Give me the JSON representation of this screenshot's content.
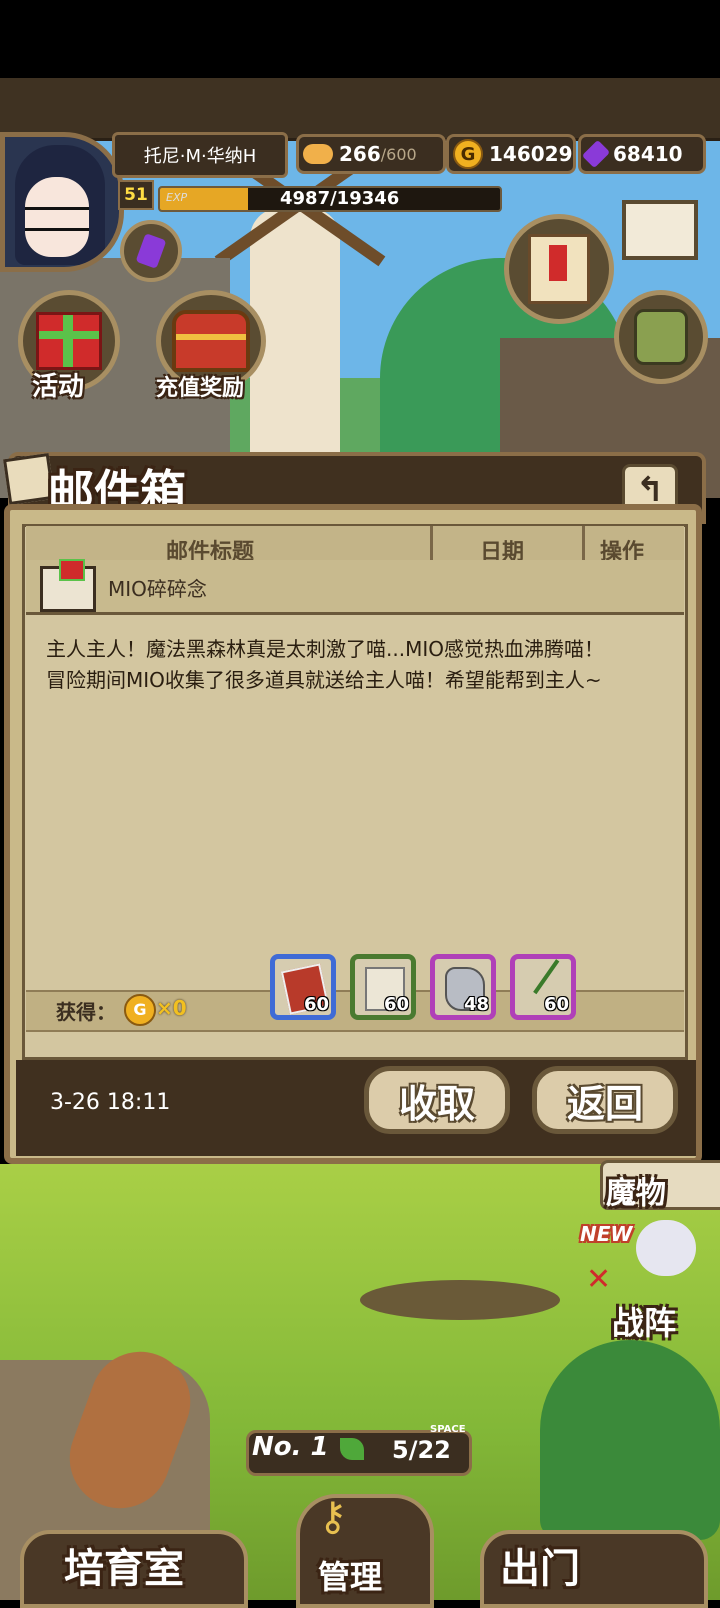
{
  "player": {
    "name": "托尼·M·华纳H",
    "level": "51",
    "exp_label": "EXP",
    "exp_text": "4987/19346",
    "exp_fraction": 0.258
  },
  "resources": {
    "stamina": "266",
    "stamina_max": "/600",
    "gold": "146029",
    "gems": "68410"
  },
  "hud_buttons": {
    "activity": "活动",
    "recharge_reward": "充值奖励"
  },
  "mailbox": {
    "title": "邮件箱",
    "col_subject": "邮件标题",
    "col_date": "日期",
    "col_action": "操作",
    "subject": "MIO碎碎念",
    "body_line1": "主人主人！魔法黑森林真是太刺激了喵...MIO感觉热血沸腾喵！",
    "body_line2": "冒险期间MIO收集了很多道具就送给主人喵！希望能帮到主人~",
    "obtain_label": "获得：",
    "gold_reward": "×0",
    "items": [
      {
        "count": "60",
        "border": "#3f6bd6"
      },
      {
        "count": "60",
        "border": "#4a7a30"
      },
      {
        "count": "48",
        "border": "#b040b8"
      },
      {
        "count": "60",
        "border": "#b040b8"
      }
    ],
    "date": "3-26 18:11",
    "collect_label": "收取",
    "return_label": "返回"
  },
  "bottom": {
    "monster": "魔物",
    "battle": "战阵",
    "new_badge": "NEW",
    "floor_label": "No. 1",
    "space_tag": "SPACE",
    "space_value": "5/22",
    "nav_nursery": "培育室",
    "nav_manage": "管理",
    "nav_exit": "出门"
  },
  "colors": {
    "panel_dark": "#40301f",
    "panel_light": "#d3c6a0",
    "frame": "#8b6e48",
    "gold": "#f0b020",
    "gem": "#8a3ad8"
  }
}
